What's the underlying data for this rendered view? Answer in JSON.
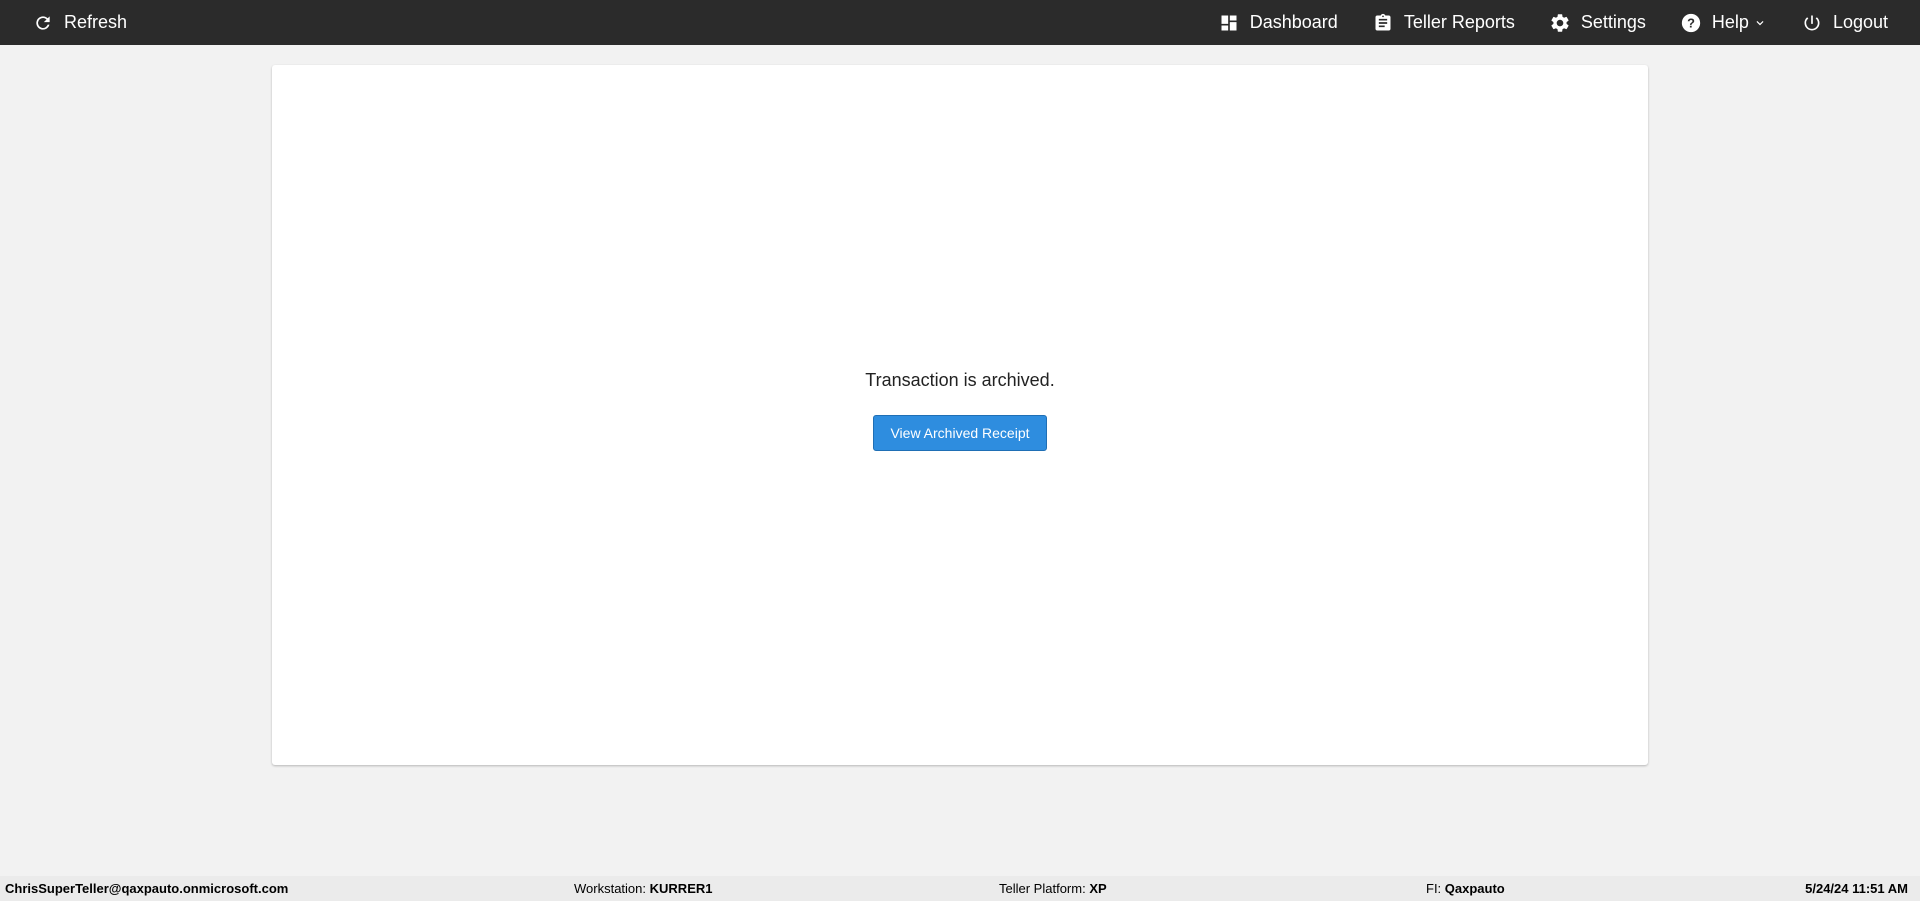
{
  "nav": {
    "refresh_label": "Refresh",
    "items": [
      {
        "label": "Dashboard",
        "icon": "dashboard-icon"
      },
      {
        "label": "Teller Reports",
        "icon": "clipboard-icon"
      },
      {
        "label": "Settings",
        "icon": "gear-icon"
      },
      {
        "label": "Help",
        "icon": "help-icon"
      },
      {
        "label": "Logout",
        "icon": "power-icon"
      }
    ]
  },
  "main": {
    "message": "Transaction is archived.",
    "view_receipt_label": "View Archived Receipt"
  },
  "status": {
    "user": "ChrisSuperTeller@qaxpauto.onmicrosoft.com",
    "workstation_label": "Workstation:",
    "workstation_value": "KURRER1",
    "platform_label": "Teller Platform:",
    "platform_value": "XP",
    "fi_label": "FI:",
    "fi_value": "Qaxpauto",
    "datetime": "5/24/24 11:51 AM"
  },
  "colors": {
    "topbar": "#2b2b2b",
    "button": "#2e8ddf",
    "background": "#f2f2f2"
  }
}
